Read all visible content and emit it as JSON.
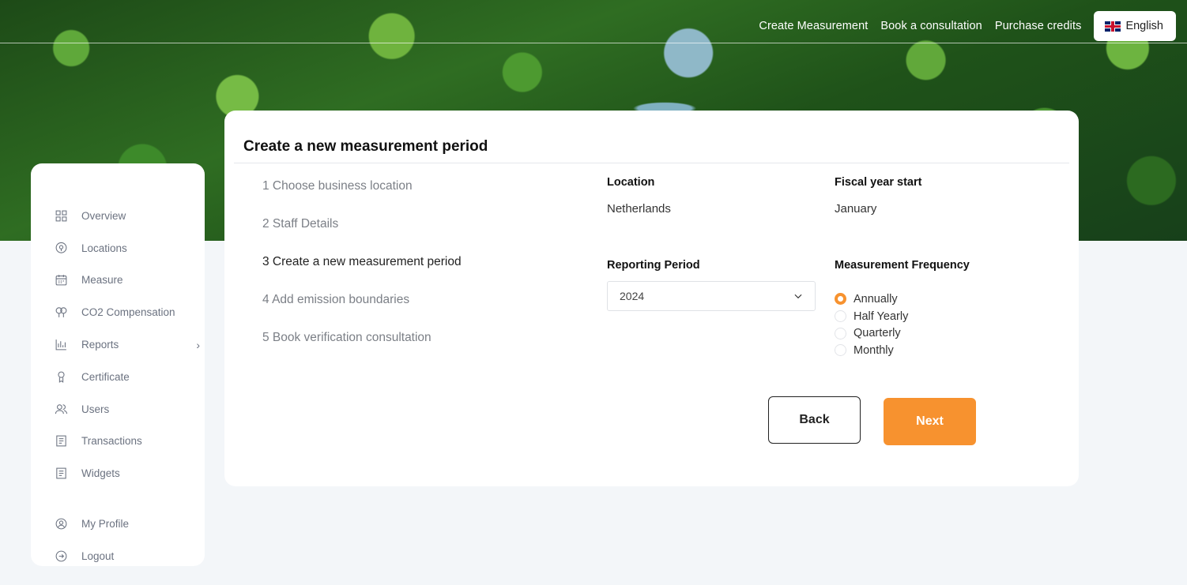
{
  "topnav": {
    "links": [
      "Create Measurement",
      "Book a consultation",
      "Purchase credits"
    ],
    "language": "English",
    "flag_icon": "uk-flag-icon"
  },
  "sidebar": {
    "items": [
      {
        "label": "Overview",
        "icon": "grid-icon"
      },
      {
        "label": "Locations",
        "icon": "map-pin-icon"
      },
      {
        "label": "Measure",
        "icon": "calendar-icon"
      },
      {
        "label": "CO2 Compensation",
        "icon": "trees-icon"
      },
      {
        "label": "Reports",
        "icon": "bar-chart-icon"
      },
      {
        "label": "Certificate",
        "icon": "award-icon"
      },
      {
        "label": "Users",
        "icon": "users-icon"
      },
      {
        "label": "Transactions",
        "icon": "receipt-icon"
      },
      {
        "label": "Widgets",
        "icon": "receipt-icon"
      }
    ],
    "bottom_items": [
      {
        "label": "My Profile",
        "icon": "user-circle-icon"
      },
      {
        "label": "Logout",
        "icon": "logout-icon"
      }
    ]
  },
  "card": {
    "title": "Create a new measurement period",
    "steps": [
      "1 Choose business location",
      "2 Staff Details",
      "3 Create a new measurement period",
      "4 Add emission boundaries",
      "5 Book verification consultation"
    ],
    "active_step": 3,
    "location_label": "Location",
    "location_value": "Netherlands",
    "fiscal_label": "Fiscal year start",
    "fiscal_value": "January",
    "reporting_label": "Reporting Period",
    "reporting_value": "2024",
    "frequency_label": "Measurement Frequency",
    "frequency_options": [
      "Annually",
      "Half Yearly",
      "Quarterly",
      "Monthly"
    ],
    "frequency_selected": "Annually",
    "back_label": "Back",
    "next_label": "Next"
  },
  "colors": {
    "accent": "#f7922f",
    "sidebar_text": "#6b7280"
  }
}
